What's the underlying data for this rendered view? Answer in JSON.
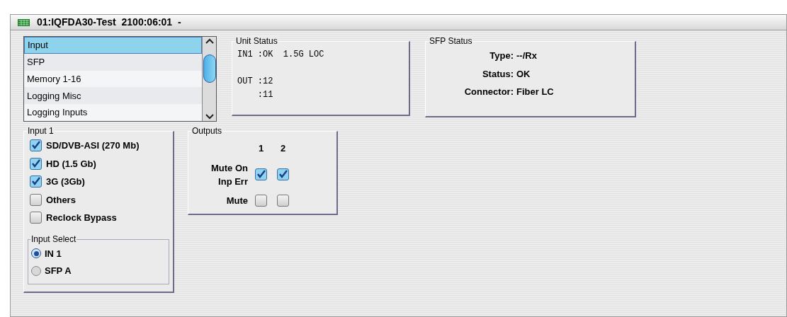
{
  "window": {
    "title": "01:IQFDA30-Test  2100:06:01  -"
  },
  "menu_list": {
    "items": [
      {
        "label": "Input",
        "selected": true
      },
      {
        "label": "SFP",
        "selected": false
      },
      {
        "label": "Memory 1-16",
        "selected": false
      },
      {
        "label": "Logging Misc",
        "selected": false
      },
      {
        "label": "Logging Inputs",
        "selected": false
      }
    ]
  },
  "unit_status": {
    "title": "Unit Status",
    "input_lines": [
      "IN1 :OK  1.5G LOC"
    ],
    "output_lines": [
      "OUT :12",
      "    :11"
    ]
  },
  "sfp_status": {
    "title": "SFP Status",
    "rows": [
      {
        "label": "Type:",
        "value": "--/Rx"
      },
      {
        "label": "Status:",
        "value": "OK"
      },
      {
        "label": "Connector:",
        "value": "Fiber LC"
      }
    ]
  },
  "input_1": {
    "title": "Input 1",
    "options": [
      {
        "label": "SD/DVB-ASI (270 Mb)",
        "checked": true
      },
      {
        "label": "HD (1.5 Gb)",
        "checked": true
      },
      {
        "label": "3G (3Gb)",
        "checked": true
      },
      {
        "label": "Others",
        "checked": false
      },
      {
        "label": "Reclock Bypass",
        "checked": false
      }
    ],
    "input_select": {
      "title": "Input Select",
      "options": [
        {
          "label": "IN 1",
          "selected": true
        },
        {
          "label": "SFP A",
          "selected": false
        }
      ]
    }
  },
  "outputs": {
    "title": "Outputs",
    "columns": [
      "1",
      "2"
    ],
    "rows": [
      {
        "label": "Mute On Inp Err",
        "checked": [
          true,
          true
        ]
      },
      {
        "label": "Mute",
        "checked": [
          false,
          false
        ]
      }
    ]
  }
}
